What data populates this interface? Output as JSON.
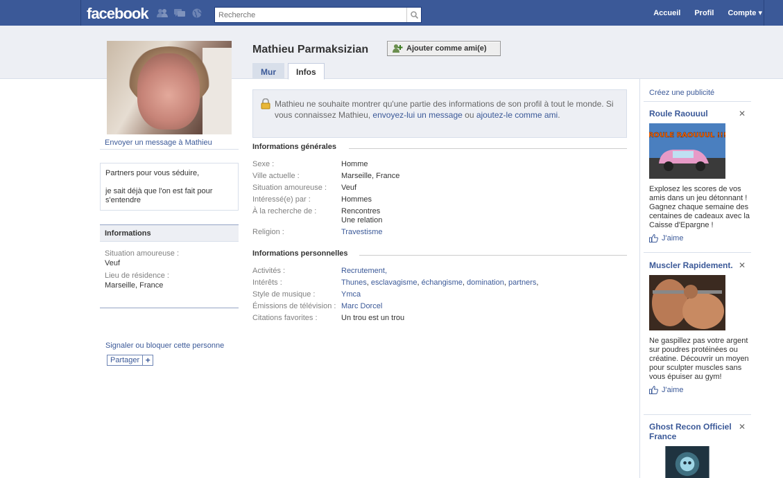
{
  "header": {
    "logo": "facebook",
    "search_placeholder": "Recherche",
    "nav": [
      "Accueil",
      "Profil",
      "Compte ▾"
    ]
  },
  "profile": {
    "name": "Mathieu Parmaksizian",
    "add_friend_label": "Ajouter comme ami(e)",
    "send_message": "Envoyer un message à Mathieu",
    "tabs": [
      "Mur",
      "Infos"
    ],
    "bio": [
      "Partners pour vous séduire,",
      "je sait déjà que l'on est fait pour s'entendre"
    ],
    "sidebar_info": {
      "title": "Informations",
      "items": [
        {
          "label": "Situation amoureuse :",
          "value": "Veuf"
        },
        {
          "label": "Lieu de résidence :",
          "value": "Marseille, France"
        }
      ]
    },
    "report_link": "Signaler ou bloquer cette personne",
    "share_label": "Partager"
  },
  "privacy": {
    "text_start": "Mathieu ne souhaite montrer qu'une partie des informations de son profil à tout le monde. Si vous connaissez Mathieu, ",
    "link1": "envoyez-lui un message",
    "middle": " ou ",
    "link2": "ajoutez-le comme ami",
    "end": "."
  },
  "general_info": {
    "title": "Informations générales",
    "rows": [
      {
        "label": "Sexe :",
        "value": "Homme"
      },
      {
        "label": "Ville actuelle :",
        "value": "Marseille, France"
      },
      {
        "label": "Situation amoureuse :",
        "value": "Veuf"
      },
      {
        "label": "Intéressé(e) par :",
        "value": "Hommes"
      },
      {
        "label": "À la recherche de :",
        "value": "Rencontres",
        "value2": "Une relation"
      },
      {
        "label": "Religion :",
        "value": "Travestisme"
      }
    ]
  },
  "personal_info": {
    "title": "Informations personnelles",
    "rows": [
      {
        "label": "Activités :",
        "value": "Recrutement,"
      },
      {
        "label": "Intérêts :",
        "links": [
          "Thunes",
          "esclavagisme",
          "échangisme",
          "domination",
          "partners"
        ]
      },
      {
        "label": "Style de musique :",
        "value": "Ymca"
      },
      {
        "label": "Émissions de télévision :",
        "value": "Marc Dorcel"
      },
      {
        "label": "Citations favorites :",
        "value": "Un trou est un trou"
      }
    ]
  },
  "ads": {
    "create_label": "Créez une publicité",
    "like_label": "J'aime",
    "items": [
      {
        "title": "Roule Raouuul",
        "image_text": "ROULE RAOUUUL !!!",
        "body": "Explosez les scores de vos amis dans un jeu détonnant ! Gagnez chaque semaine des centaines de cadeaux avec la Caisse d'Epargne !"
      },
      {
        "title": "Muscler Rapidement.",
        "body": "Ne gaspillez pas votre argent sur poudres protéinées ou créatine. Découvrir un moyen pour sculpter muscles sans vous épuiser au gym!"
      },
      {
        "title": "Ghost Recon Officiel France"
      }
    ]
  }
}
